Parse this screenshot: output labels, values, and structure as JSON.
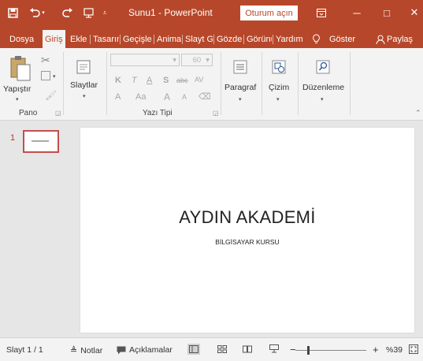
{
  "titlebar": {
    "title": "Sunu1  -  PowerPoint",
    "signin": "Oturum açın",
    "save_icon": "save-icon",
    "undo_icon": "undo-icon",
    "redo_icon": "redo-icon",
    "present_icon": "present-from-start-icon",
    "ribbon_display_icon": "ribbon-display-options-icon",
    "minimize": "─",
    "maximize": "□",
    "close": "✕"
  },
  "tabs": [
    {
      "label": "Dosya"
    },
    {
      "label": "Giriş",
      "active": true
    },
    {
      "label": "Ekle"
    },
    {
      "label": "Tasarım"
    },
    {
      "label": "Geçişle"
    },
    {
      "label": "Animas"
    },
    {
      "label": "Slayt Gö"
    },
    {
      "label": "Gözder"
    },
    {
      "label": "Görünü"
    },
    {
      "label": "Yardım"
    },
    {
      "label": "Göster"
    }
  ],
  "share_label": "Paylaş",
  "ribbon": {
    "paste_label": "Yapıştır",
    "clipboard_group": "Pano",
    "slides_label": "Slaytlar",
    "font_size_value": "60",
    "font_group": "Yazı Tipi",
    "paragraph_label": "Paragraf",
    "drawing_label": "Çizim",
    "editing_label": "Düzenleme",
    "bold": "K",
    "italic": "T",
    "underline": "A",
    "strike": "S",
    "abc": "abc",
    "spacing": "AV",
    "font_color": "A",
    "case": "Aa",
    "grow": "A",
    "shrink": "A"
  },
  "thumbnails": [
    {
      "number": "1"
    }
  ],
  "slide": {
    "title": "AYDIN AKADEMİ",
    "subtitle": "BİLGİSAYAR KURSU"
  },
  "statusbar": {
    "slide_info": "Slayt 1 / 1",
    "notes": "Notlar",
    "comments": "Açıklamalar",
    "zoom_minus": "−",
    "zoom_plus": "+",
    "zoom_level": "%39",
    "zoom_fraction": 0.39
  },
  "colors": {
    "accent": "#b7472a",
    "selection": "#c0504d"
  }
}
